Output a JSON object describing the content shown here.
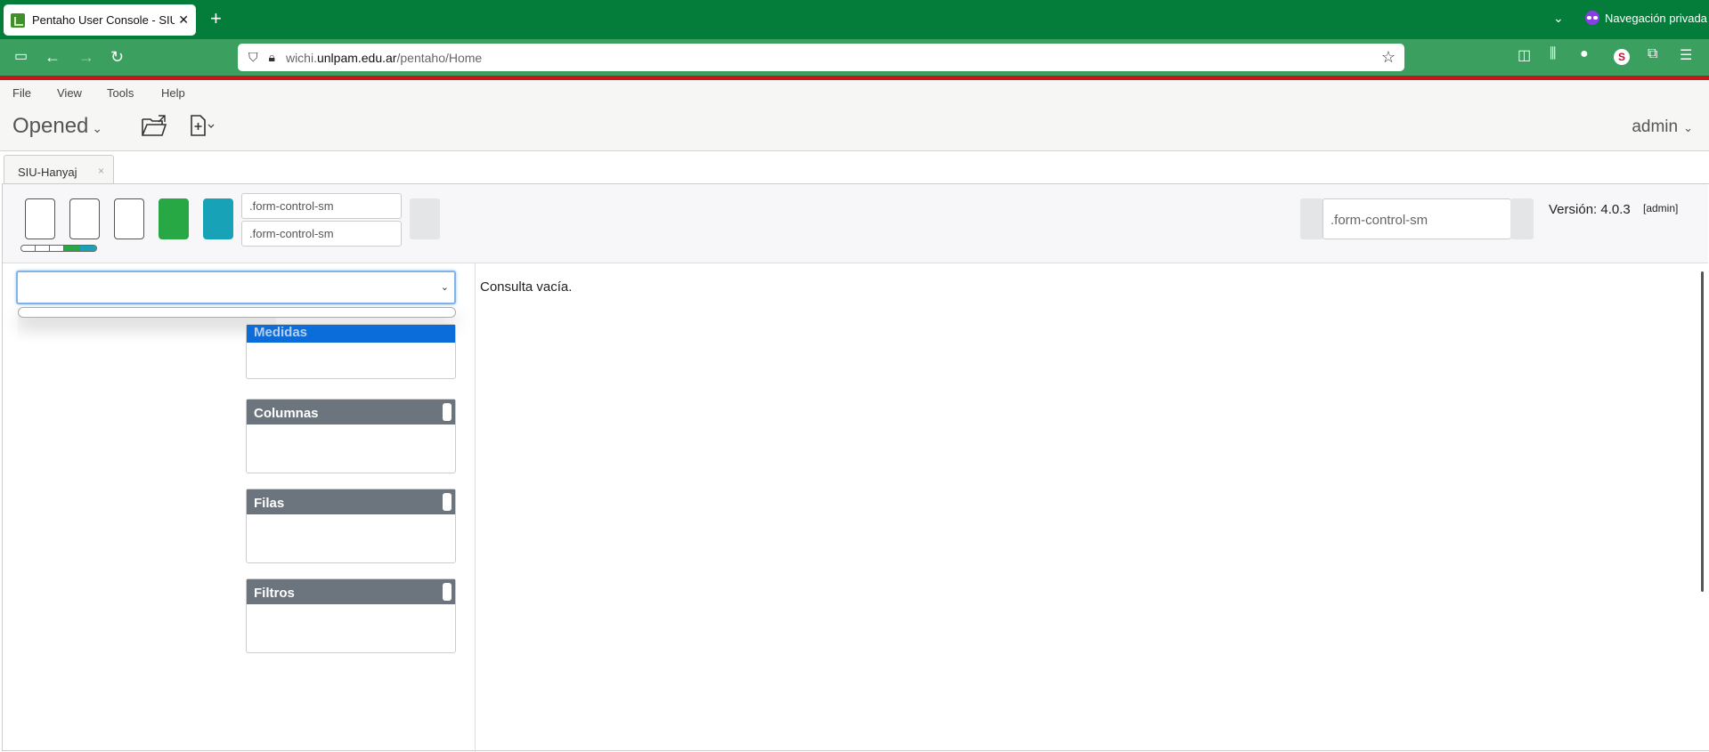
{
  "browser": {
    "tab_title": "Pentaho User Console - SIU-Ha",
    "new_tab_icon": "plus-icon",
    "private_label": "Navegación privada",
    "url_prefix": "wichi.",
    "url_domain": "unlpam.edu.ar",
    "url_path": "/pentaho/Home"
  },
  "menu": {
    "items": [
      "File",
      "View",
      "Tools",
      "Help"
    ]
  },
  "toolbar": {
    "perspective": "Opened",
    "user": "admin"
  },
  "doc_tab": {
    "label": "SIU-Hanyaj",
    "close": "×"
  },
  "saiku": {
    "input_top_placeholder": ".form-control-sm",
    "input_bottom_placeholder": ".form-control-sm",
    "search_placeholder": ".form-control-sm",
    "version": "Versión: 4.0.3",
    "admin_tag": "[admin]",
    "progress_segments": [
      {
        "color": "#ffffff"
      },
      {
        "color": "#ffffff"
      },
      {
        "color": "#ffffff"
      },
      {
        "color": "#28a745"
      },
      {
        "color": "#17a2b8"
      }
    ]
  },
  "axes": {
    "measures": "Medidas",
    "columns": "Columnas",
    "rows": "Filas",
    "filters": "Filtros"
  },
  "result": {
    "empty_text": "Consulta vacía."
  },
  "colors": {
    "browser_green": "#047d3a",
    "nav_green": "#3a9f5f",
    "accent_red": "#c8161d",
    "axis_gray": "#6c757d",
    "selected_blue": "#0a6dd9"
  }
}
